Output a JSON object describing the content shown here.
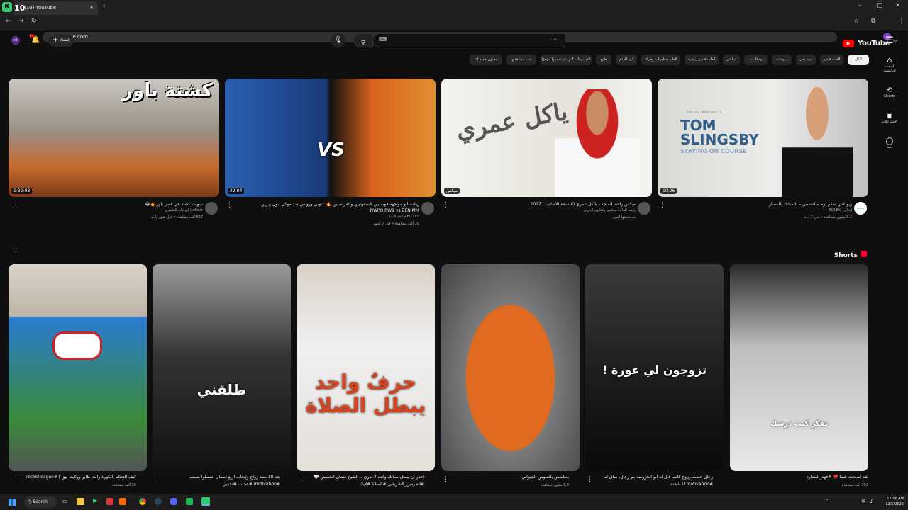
{
  "browser": {
    "tab_title": "(10) YouTube",
    "tab_badge": "10",
    "url": "youtube.com"
  },
  "header": {
    "logo": "YouTube",
    "region": "KW",
    "search_placeholder": "بحث",
    "create_label": "إنشاء",
    "notif_count": "9+"
  },
  "sidebar": [
    {
      "label": "الصفحة الرئيسية",
      "icon": "home-icon"
    },
    {
      "label": "Shorts",
      "icon": "shorts-icon"
    },
    {
      "label": "الاشتراكات",
      "icon": "subscriptions-icon"
    },
    {
      "label": "أنت",
      "icon": "user-icon"
    }
  ],
  "chips": [
    "الكل",
    "ألعاب فيديو",
    "موسيقى",
    "مزيجات",
    "بودكاست",
    "مباشر",
    "ألعاب فيديو رياضية",
    "ألعاب مغامرات وحركة",
    "كرة القدم",
    "طبخ",
    "الفيديوهات التي تم تحميلها مؤخرًا",
    "تمت مشاهدتها",
    "محتوى جديد لك"
  ],
  "videos": [
    {
      "title": "زيولكس تقدّم توم سلنغسبي – التمسّك بالمسار",
      "channel": "إعلان · ROLEX",
      "meta": "8.2 مليون مشاهدة • قبل 7 أيام",
      "duration": "10:26",
      "thumb_text": "TOM SLINGSBY",
      "thumb_sub": "STAYING ON COURSE",
      "thumb_brand": "ROLEX PRESENTS",
      "avatar_text": "ROLEX"
    },
    {
      "title": "ميكس راشد الماجد - يا كل عمري (النسخة الأصلية) | 2017",
      "channel": "راشد الماجد وعايض وفنانون آخرون",
      "meta": "تم تحديثها اليوم",
      "duration": "ميكس",
      "thumb_text": "ياكل عمري"
    },
    {
      "title": "ريكت أبو مواجهه قويه بين السعوديين والفرنسيين 🔥 : توبي وروبس ضد موكي مون و زين",
      "title2": "NWPO RW9 vs ZEN MM",
      "channel": "ABU LEL (بطولات)",
      "meta": "39 ألف مشاهدة • قبل 7 أشهر",
      "duration": "22:04",
      "thumb_text": "VS"
    },
    {
      "title": "سويت كشتة في قصر باور 🔥😂",
      "channel": "xBear | أبو عابد الشمري",
      "meta": "827 ألف مشاهدة • قبل شهر واحد",
      "duration": "1:32:08",
      "thumb_text": "كشتة باور"
    }
  ],
  "shorts_title": "Shorts",
  "shorts": [
    {
      "title": "لقد أصبحت شيئا 💔 #فهد_البشارة",
      "meta": "392 ألف مشاهدة",
      "overlay": "تفكر كنت درسك"
    },
    {
      "title": "رجال خطب وزوج كاتب قال له أبو الخروسة مو رجال، ساق له",
      "title2": "#motivation !! شحنة",
      "meta": "",
      "overlay": "تزوجون لي عورة !"
    },
    {
      "title": "بطاطس بالسوس الجيزاني",
      "meta": "1.3 مليون مشاهدة",
      "overlay": ""
    },
    {
      "title": "احذر أن يبطل صلاتك وأنت لا تدري .. الشيخ عثمان الخميس 🤍",
      "title2": "#الحرمين_الشريفين #الصلاة #لايك",
      "meta": "",
      "overlay": "حرفٌ واحد يبطل الصلاة"
    },
    {
      "title": "بعد 18 سنة زواج وإنجاب أربع أطفال انفصلوا بسبب",
      "title2": "#motivation #عجيب #تحفيز",
      "meta": "",
      "overlay": "طلقني"
    },
    {
      "title": "كيف التحكم بالكورة وأنت طاير روكيت ليق | #rocketleague",
      "meta": "39 ألف مشاهدة",
      "overlay": ""
    }
  ],
  "taskbar": {
    "search": "Search",
    "time": "11:06 AM",
    "date": "12/5/2025"
  }
}
